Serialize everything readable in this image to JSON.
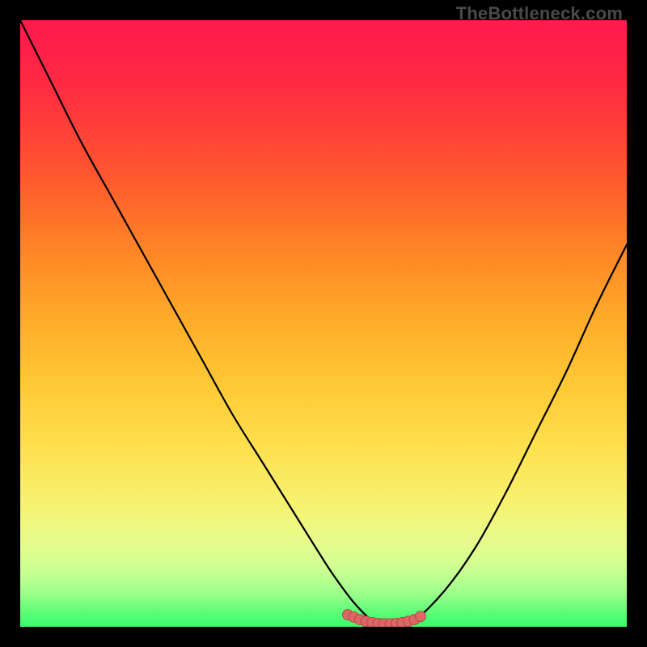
{
  "watermark": "TheBottleneck.com",
  "colors": {
    "stops": [
      {
        "offset": 0.0,
        "hex": "#ff1b4e"
      },
      {
        "offset": 0.05,
        "hex": "#ff2148"
      },
      {
        "offset": 0.1,
        "hex": "#ff2a42"
      },
      {
        "offset": 0.15,
        "hex": "#ff373c"
      },
      {
        "offset": 0.2,
        "hex": "#ff4636"
      },
      {
        "offset": 0.25,
        "hex": "#ff5630"
      },
      {
        "offset": 0.3,
        "hex": "#ff682b"
      },
      {
        "offset": 0.35,
        "hex": "#ff7a28"
      },
      {
        "offset": 0.4,
        "hex": "#ff8c27"
      },
      {
        "offset": 0.45,
        "hex": "#ff9d28"
      },
      {
        "offset": 0.5,
        "hex": "#ffad2a"
      },
      {
        "offset": 0.55,
        "hex": "#ffbb2e"
      },
      {
        "offset": 0.6,
        "hex": "#ffc836"
      },
      {
        "offset": 0.65,
        "hex": "#ffd440"
      },
      {
        "offset": 0.7,
        "hex": "#fedf4e"
      },
      {
        "offset": 0.75,
        "hex": "#fbe95f"
      },
      {
        "offset": 0.8,
        "hex": "#f6f271"
      },
      {
        "offset": 0.83,
        "hex": "#f0f780"
      },
      {
        "offset": 0.86,
        "hex": "#e6fb8b"
      },
      {
        "offset": 0.89,
        "hex": "#d8fe91"
      },
      {
        "offset": 0.91,
        "hex": "#c6ff92"
      },
      {
        "offset": 0.93,
        "hex": "#b1ff8f"
      },
      {
        "offset": 0.947,
        "hex": "#98ff89"
      },
      {
        "offset": 0.96,
        "hex": "#7eff81"
      },
      {
        "offset": 0.972,
        "hex": "#65fe79"
      },
      {
        "offset": 0.983,
        "hex": "#51fd73"
      },
      {
        "offset": 0.992,
        "hex": "#43fc6f"
      },
      {
        "offset": 1.0,
        "hex": "#3dfc6d"
      }
    ],
    "curve_stroke": "#000000",
    "marker_fill": "#e06666",
    "marker_stroke": "#a04040"
  },
  "chart_data": {
    "type": "line",
    "title": "",
    "xlabel": "",
    "ylabel": "",
    "xlim": [
      0,
      100
    ],
    "ylim": [
      0,
      100
    ],
    "series": [
      {
        "name": "bottleneck-curve",
        "x": [
          0,
          5,
          10,
          15,
          20,
          25,
          30,
          35,
          40,
          45,
          50,
          52,
          55,
          58,
          60,
          62,
          65,
          70,
          75,
          80,
          85,
          90,
          95,
          100
        ],
        "y": [
          100,
          90,
          80,
          71,
          62,
          53,
          44,
          35,
          27,
          19,
          11,
          8,
          4,
          1,
          0,
          0,
          1,
          6,
          13,
          22,
          32,
          42,
          53,
          63
        ]
      }
    ],
    "markers": {
      "name": "highlight-band",
      "x": [
        54,
        55,
        56,
        57,
        58,
        59,
        60,
        61,
        62,
        63,
        64,
        65,
        66
      ],
      "y": [
        2,
        1.6,
        1.2,
        0.9,
        0.7,
        0.55,
        0.5,
        0.5,
        0.55,
        0.7,
        0.9,
        1.2,
        1.7
      ]
    }
  }
}
